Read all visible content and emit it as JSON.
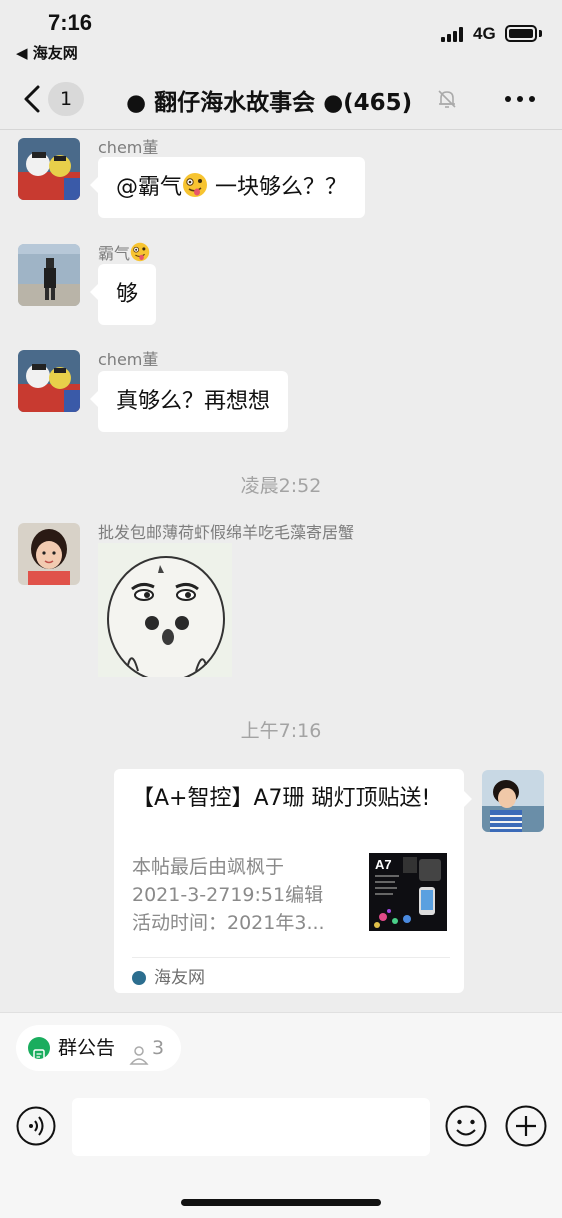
{
  "status_bar": {
    "time": "7:16",
    "back_app": "◀ 海友网",
    "network": "4G"
  },
  "nav": {
    "unread_count": "1",
    "title": "● 翻仔海水故事会 ●(465)",
    "icons": {
      "back": "chevron-left-icon",
      "mute": "bell-off-icon",
      "more": "more-dots-icon"
    }
  },
  "messages": [
    {
      "sender": "chem董",
      "text_before": "@霸气",
      "emoji": "zany-face-emoji",
      "text_after": " 一块够么？？"
    },
    {
      "sender": "霸气",
      "sender_emoji": "zany-face-emoji",
      "text": "够"
    },
    {
      "sender": "chem董",
      "text": "真够么？再想想"
    }
  ],
  "time_separators": [
    "凌晨2:52",
    "上午7:16"
  ],
  "sticker_message": {
    "sender": "批发包邮薄荷虾假绵羊吃毛藻寄居蟹"
  },
  "link_card": {
    "title": "【A+智控】A7珊 瑚灯顶贴送!",
    "desc_lines": [
      "本帖最后由飒枫于",
      "2021-3-2719:51编辑",
      "活动时间：2021年3..."
    ],
    "thumb_label": "A7",
    "source": "海友网"
  },
  "bottom": {
    "notice_label": "群公告",
    "notice_count": "3",
    "input_placeholder": "",
    "icons": {
      "voice": "voice-icon",
      "emoji": "emoji-icon",
      "plus": "plus-icon",
      "notice": "notice-icon"
    }
  },
  "colors": {
    "background": "#ededed",
    "bubble": "#ffffff",
    "accent_green": "#1aad5e"
  }
}
